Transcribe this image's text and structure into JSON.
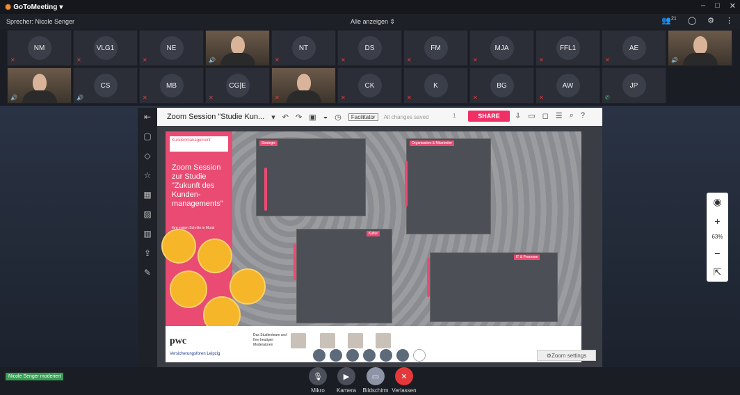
{
  "app": {
    "title": "GoToMeeting"
  },
  "window": {
    "controls": [
      "–",
      "□",
      "✕"
    ]
  },
  "speakerbar": {
    "speaker": "Sprecher: Nicole Senger",
    "show_all": "Alle anzeigen",
    "participants_count": "21"
  },
  "participants": [
    {
      "initials": "NM",
      "mic": "muted"
    },
    {
      "initials": "VLG1",
      "mic": "muted"
    },
    {
      "initials": "NE",
      "mic": "muted"
    },
    {
      "initials": "",
      "mic": "on",
      "video": true
    },
    {
      "initials": "NT",
      "mic": "muted"
    },
    {
      "initials": "DS",
      "mic": "muted"
    },
    {
      "initials": "FM",
      "mic": "muted"
    },
    {
      "initials": "MJA",
      "mic": "muted"
    },
    {
      "initials": "FFL1",
      "mic": "muted"
    },
    {
      "initials": "AE",
      "mic": "muted"
    },
    {
      "initials": "",
      "mic": "on",
      "video": true
    },
    {
      "initials": "",
      "mic": "on",
      "video": true
    },
    {
      "initials": "CS",
      "mic": "on"
    },
    {
      "initials": "MB",
      "mic": "muted"
    },
    {
      "initials": "CG|E",
      "mic": "muted"
    },
    {
      "initials": "",
      "mic": "muted",
      "video": true
    },
    {
      "initials": "CK",
      "mic": "muted"
    },
    {
      "initials": "K",
      "mic": "muted"
    },
    {
      "initials": "BG",
      "mic": "muted"
    },
    {
      "initials": "AW",
      "mic": "muted"
    },
    {
      "initials": "JP",
      "mic": "phone"
    }
  ],
  "mural": {
    "session_title": "Zoom Session \"Studie Kun...",
    "facilitator": "Facilitator",
    "saved_status": "All changes saved",
    "user_count": "1",
    "share_label": "SHARE",
    "brand_title": "Kundenmanagement",
    "board_title": "Zoom Session zur Studie \"Zukunft des Kunden-managements\"",
    "board_subtitle": "Ihre ersten Schritte in Mural",
    "sections": [
      "Strategie",
      "Organisation & Mitarbeiter",
      "Kultur",
      "IT & Prozesse"
    ],
    "pwc": "pwc",
    "vf": "Versicherungsforen Leipzig",
    "team_text": "Das Studienteam und Ihre heutigen Moderatoren",
    "zoom_settings": "Zoom settings",
    "zoom_level": "63%"
  },
  "controls": [
    {
      "label": "Mikro"
    },
    {
      "label": "Kamera"
    },
    {
      "label": "Bildschirm"
    },
    {
      "label": "Verlassen"
    }
  ],
  "moderator_badge": "Nicole Senger moderiert",
  "colors": {
    "accent": "#ef2f66",
    "brand_orange": "#f68d2e",
    "muted_red": "#e0403f",
    "mic_green": "#3fc56b"
  }
}
